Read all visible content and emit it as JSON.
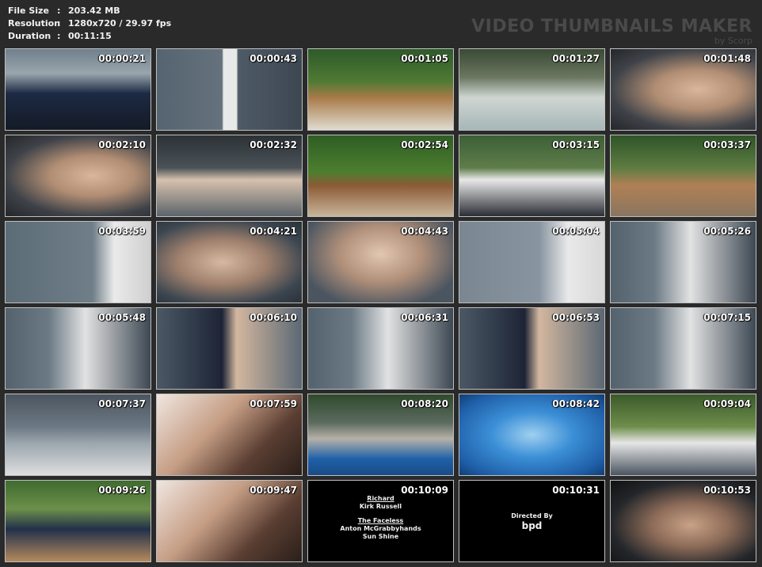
{
  "header": {
    "file_size": {
      "label": "File Size",
      "sep": ":",
      "value": "203.42 MB"
    },
    "resolution": {
      "label": "Resolution",
      "sep": ":",
      "value": "1280x720 / 29.97 fps"
    },
    "duration": {
      "label": "Duration",
      "sep": ":",
      "value": "00:11:15"
    }
  },
  "watermark": {
    "title": "VIDEO THUMBNAILS MAKER",
    "by": "by Scorp"
  },
  "thumbnails": [
    {
      "time": "00:00:21",
      "scene": "car-driveway"
    },
    {
      "time": "00:00:43",
      "scene": "couple-doorway"
    },
    {
      "time": "00:01:05",
      "scene": "deck-stairs"
    },
    {
      "time": "00:01:27",
      "scene": "hot-tub"
    },
    {
      "time": "00:01:48",
      "scene": "woman-closeup"
    },
    {
      "time": "00:02:10",
      "scene": "woman-closeup"
    },
    {
      "time": "00:02:32",
      "scene": "hot-tub-relax"
    },
    {
      "time": "00:02:54",
      "scene": "deck-man"
    },
    {
      "time": "00:03:15",
      "scene": "deck-struggle"
    },
    {
      "time": "00:03:37",
      "scene": "deck-wide"
    },
    {
      "time": "00:03:59",
      "scene": "wall-corner"
    },
    {
      "time": "00:04:21",
      "scene": "face-closeup"
    },
    {
      "time": "00:04:43",
      "scene": "grab-closeup"
    },
    {
      "time": "00:05:04",
      "scene": "man-wall"
    },
    {
      "time": "00:05:26",
      "scene": "wall-restrain"
    },
    {
      "time": "00:05:48",
      "scene": "wall-restrain"
    },
    {
      "time": "00:06:10",
      "scene": "wall-closeup"
    },
    {
      "time": "00:06:31",
      "scene": "wall-restrain"
    },
    {
      "time": "00:06:53",
      "scene": "wall-closeup"
    },
    {
      "time": "00:07:15",
      "scene": "wall-restrain"
    },
    {
      "time": "00:07:37",
      "scene": "porch-carry"
    },
    {
      "time": "00:07:59",
      "scene": "closeup-skin"
    },
    {
      "time": "00:08:20",
      "scene": "poolside"
    },
    {
      "time": "00:08:42",
      "scene": "pool-water"
    },
    {
      "time": "00:09:04",
      "scene": "poolside-trees"
    },
    {
      "time": "00:09:26",
      "scene": "deck-lying"
    },
    {
      "time": "00:09:47",
      "scene": "closeup-skin"
    },
    {
      "time": "00:10:09",
      "scene": "credits",
      "credits": {
        "role1": "Richard",
        "name1": "Kirk Russell",
        "role2": "The Faceless",
        "name2a": "Anton McGrabbyhands",
        "name2b": "Sun Shine"
      }
    },
    {
      "time": "00:10:31",
      "scene": "directed",
      "directed": {
        "line": "Directed By",
        "name": "bpd"
      }
    },
    {
      "time": "00:10:53",
      "scene": "woman-closeup-dark"
    }
  ],
  "colors": {
    "background": "#2a2a2a",
    "thumb_border": "#bfbfbf",
    "timestamp": "#ffffff"
  }
}
